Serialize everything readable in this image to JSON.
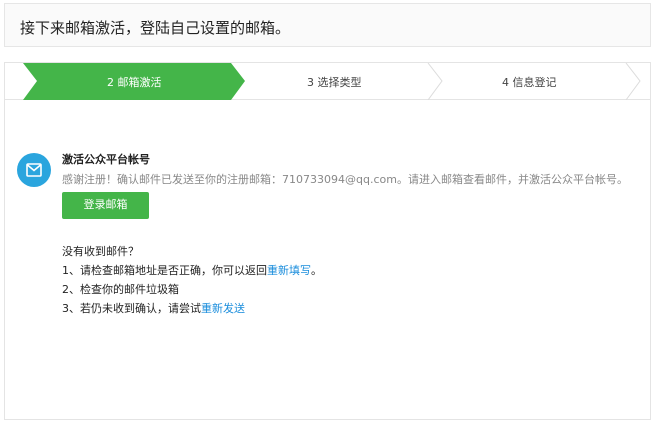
{
  "banner": {
    "text": "接下来邮箱激活，登陆自己设置的邮箱。"
  },
  "steps": [
    {
      "label": "2 邮箱激活",
      "active": true
    },
    {
      "label": "3 选择类型",
      "active": false
    },
    {
      "label": "4 信息登记",
      "active": false
    }
  ],
  "colors": {
    "accent": "#44b549",
    "link": "#1a8ddc",
    "icon_bg": "#2aa5de"
  },
  "activation": {
    "icon": "mail-icon",
    "title": "激活公众平台帐号",
    "desc": "感谢注册！确认邮件已发送至你的注册邮箱：710733094@qq.com。请进入邮箱查看邮件，并激活公众平台帐号。",
    "login_button": "登录邮箱"
  },
  "help": {
    "title": "没有收到邮件？",
    "line1_text": "1、请检查邮箱地址是否正确，你可以返回",
    "line1_link": "重新填写",
    "line1_end": "。",
    "line2_text": "2、检查你的邮件垃圾箱",
    "line3_text": "3、若仍未收到确认，请尝试",
    "line3_link": "重新发送"
  }
}
